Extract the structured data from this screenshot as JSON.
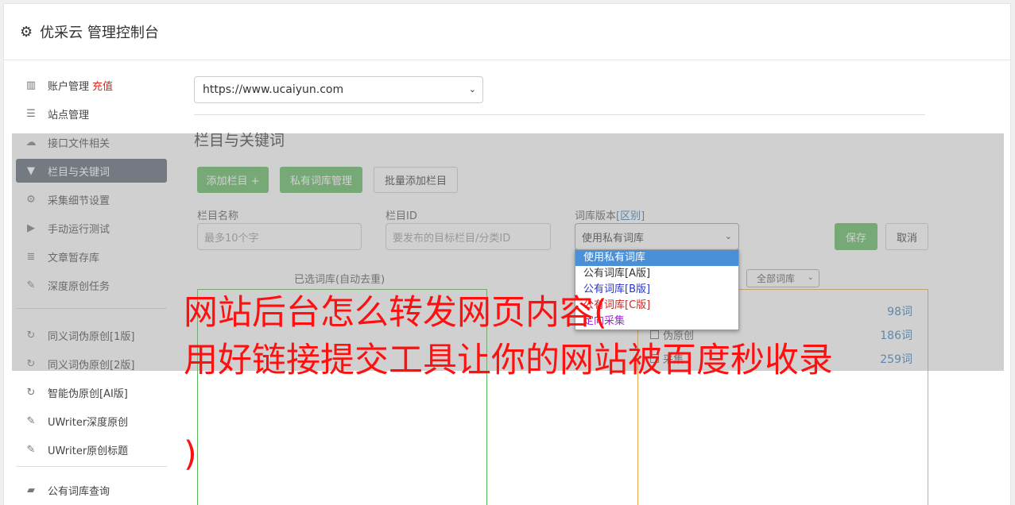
{
  "app": {
    "title": "优采云 管理控制台"
  },
  "sidebar": {
    "items": [
      {
        "icon": "bar-chart-icon",
        "label": "账户管理",
        "badge": "充值"
      },
      {
        "icon": "server-icon",
        "label": "站点管理"
      },
      {
        "icon": "cloud-upload-icon",
        "label": "接口文件相关"
      },
      {
        "icon": "filter-icon",
        "label": "栏目与关键词",
        "active": true
      },
      {
        "icon": "cogs-icon",
        "label": "采集细节设置"
      },
      {
        "icon": "play-circle-icon",
        "label": "手动运行测试"
      },
      {
        "icon": "database-icon",
        "label": "文章暂存库"
      },
      {
        "icon": "edit-icon",
        "label": "深度原创任务"
      },
      {
        "icon": "refresh-icon",
        "label": "同义词伪原创[1版]"
      },
      {
        "icon": "refresh-icon",
        "label": "同义词伪原创[2版]"
      },
      {
        "icon": "refresh-icon",
        "label": "智能伪原创[AI版]"
      },
      {
        "icon": "edit-icon",
        "label": "UWriter深度原创"
      },
      {
        "icon": "edit-icon",
        "label": "UWriter原创标题"
      },
      {
        "icon": "book-icon",
        "label": "公有词库查询"
      }
    ]
  },
  "main": {
    "site_select": "https://www.ucaiyun.com",
    "section_title": "栏目与关键词",
    "buttons": {
      "add_column": "添加栏目 +",
      "private_lexicon": "私有词库管理",
      "batch_add": "批量添加栏目"
    },
    "form": {
      "name_label": "栏目名称",
      "name_placeholder": "最多10个字",
      "id_label": "栏目ID",
      "id_placeholder": "要发布的目标栏目/分类ID",
      "lexicon_label": "词库版本",
      "lexicon_link": "[区别]",
      "lexicon_value": "使用私有词库",
      "save": "保存",
      "cancel": "取消"
    },
    "lexicon_options": [
      "使用私有词库",
      "公有词库[A版]",
      "公有词库[B版]",
      "公有词库[C版]",
      "定向采集"
    ],
    "selected_box_title": "已选词库(自动去重)",
    "filter_select": "全部词库",
    "lexicon_rows": [
      {
        "label": "",
        "count": "98词"
      },
      {
        "label": "伪原创",
        "count": "186词"
      },
      {
        "label": "采集",
        "count": "259词"
      }
    ]
  },
  "overlay_banner": {
    "line1": "网站后台怎么转发网页内容(",
    "line2": "用好链接提交工具让你的网站被百度秒收录",
    "line3": ")"
  },
  "colors": {
    "accent_green": "#5cb85c",
    "active_nav": "#5a6270",
    "banner_red": "#ff1010",
    "link_blue": "#337ab7"
  }
}
